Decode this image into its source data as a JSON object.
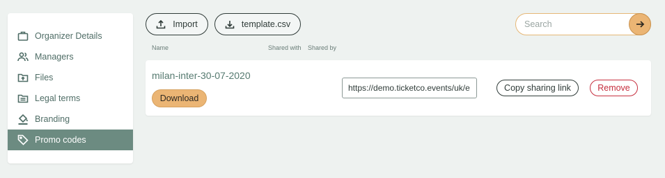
{
  "sidebar": {
    "items": [
      {
        "label": "Organizer Details",
        "icon": "briefcase-icon",
        "active": false
      },
      {
        "label": "Managers",
        "icon": "users-icon",
        "active": false
      },
      {
        "label": "Files",
        "icon": "folder-upload-icon",
        "active": false
      },
      {
        "label": "Legal terms",
        "icon": "document-folder-icon",
        "active": false
      },
      {
        "label": "Branding",
        "icon": "paint-bucket-icon",
        "active": false
      },
      {
        "label": "Promo codes",
        "icon": "tag-icon",
        "active": true
      }
    ]
  },
  "toolbar": {
    "import_label": "Import",
    "template_label": "template.csv"
  },
  "search": {
    "placeholder": "Search"
  },
  "table": {
    "headers": {
      "name": "Name",
      "shared_with": "Shared with",
      "shared_by": "Shared by"
    },
    "rows": [
      {
        "name": "milan-inter-30-07-2020",
        "download_label": "Download",
        "link": "https://demo.ticketco.events/uk/e",
        "copy_label": "Copy sharing link",
        "remove_label": "Remove"
      }
    ]
  },
  "colors": {
    "accent": "#ebb574",
    "active_nav": "#6c8b81",
    "danger": "#c62e3e"
  }
}
